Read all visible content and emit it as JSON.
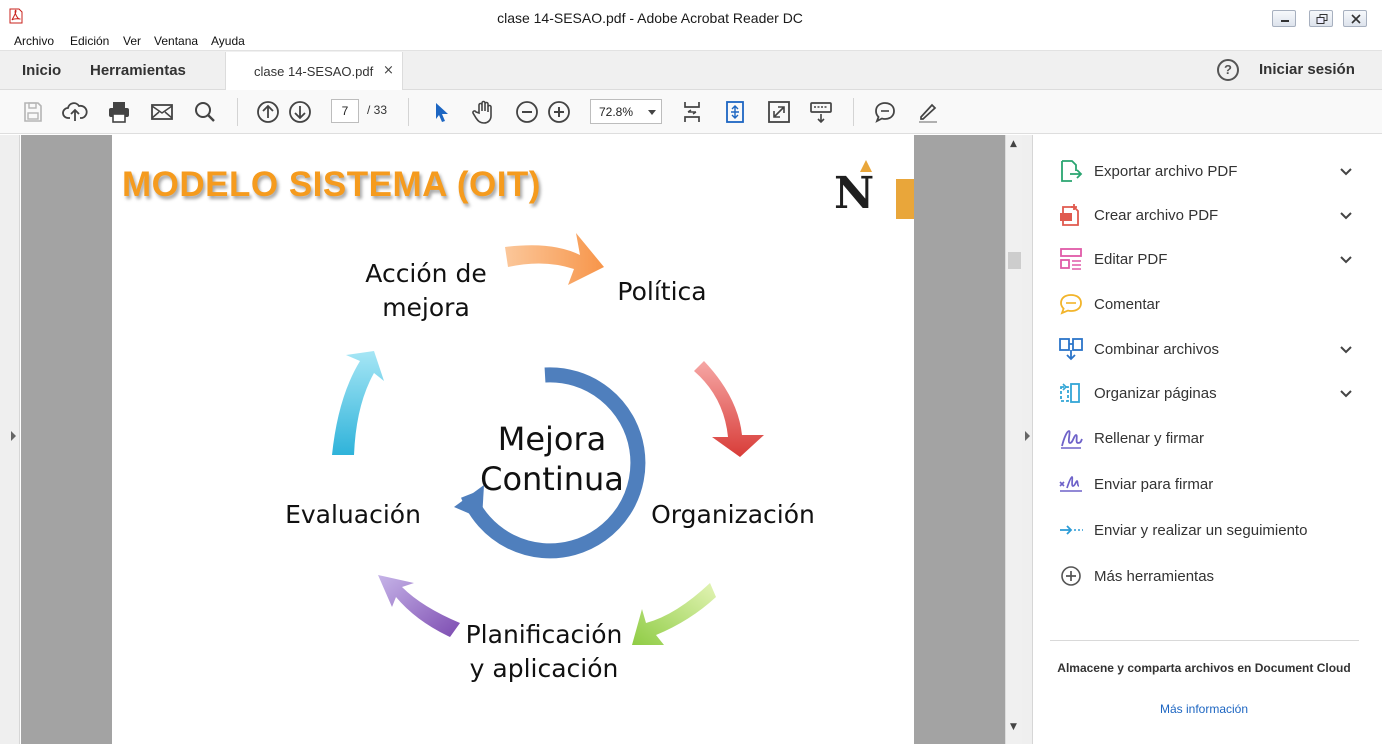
{
  "window": {
    "title": "clase 14-SESAO.pdf - Adobe Acrobat Reader DC"
  },
  "menu": [
    "Archivo",
    "Edición",
    "Ver",
    "Ventana",
    "Ayuda"
  ],
  "tabs": {
    "home": "Inicio",
    "tools": "Herramientas",
    "document": "clase 14-SESAO.pdf",
    "close_glyph": "×"
  },
  "account": {
    "help_glyph": "?",
    "signin": "Iniciar sesión"
  },
  "toolbar": {
    "current_page": "7",
    "total_pages": "/ 33",
    "zoom": "72.8%",
    "icons": [
      "save-icon",
      "upload-icon",
      "print-icon",
      "email-icon",
      "search-icon",
      "page-up-icon",
      "page-down-icon",
      "select-cursor-icon",
      "hand-icon",
      "zoom-out-icon",
      "zoom-in-icon",
      "fit-page-icon",
      "scrolling-mode-icon",
      "fullscreen-icon",
      "keyboard-icon",
      "comment-icon",
      "highlight-icon"
    ]
  },
  "slide": {
    "title": "MODELO SISTEMA (OIT)",
    "logo_letter": "N",
    "center": [
      "Mejora",
      "Continua"
    ],
    "steps": {
      "action": [
        "Acción de",
        "mejora"
      ],
      "policy": "Política",
      "organization": "Organización",
      "planning": [
        "Planificación",
        "y aplicación"
      ],
      "evaluation": "Evaluación"
    },
    "colors": {
      "title": "#f59b1e",
      "ring": "#4f7fbd",
      "arrow_orange": "#f7a056",
      "arrow_red": "#e0504d",
      "arrow_green": "#9bcf55",
      "arrow_purple": "#8e6ac2",
      "arrow_cyan": "#3cbde0"
    }
  },
  "panel": {
    "tools": [
      {
        "label": "Exportar archivo PDF",
        "icon": "export-pdf-icon",
        "expandable": true
      },
      {
        "label": "Crear archivo PDF",
        "icon": "create-pdf-icon",
        "expandable": true
      },
      {
        "label": "Editar PDF",
        "icon": "edit-pdf-icon",
        "expandable": true
      },
      {
        "label": "Comentar",
        "icon": "comment-bubble-icon",
        "expandable": false
      },
      {
        "label": "Combinar archivos",
        "icon": "combine-files-icon",
        "expandable": true
      },
      {
        "label": "Organizar páginas",
        "icon": "organize-pages-icon",
        "expandable": true
      },
      {
        "label": "Rellenar y firmar",
        "icon": "fill-sign-icon",
        "expandable": false
      },
      {
        "label": "Enviar para firmar",
        "icon": "send-sign-icon",
        "expandable": false
      },
      {
        "label": "Enviar y realizar un seguimiento",
        "icon": "send-track-icon",
        "expandable": false
      },
      {
        "label": "Más herramientas",
        "icon": "more-tools-icon",
        "expandable": false
      }
    ],
    "cloud_text": "Almacene y comparta archivos en Document Cloud",
    "cloud_link": "Más información"
  }
}
